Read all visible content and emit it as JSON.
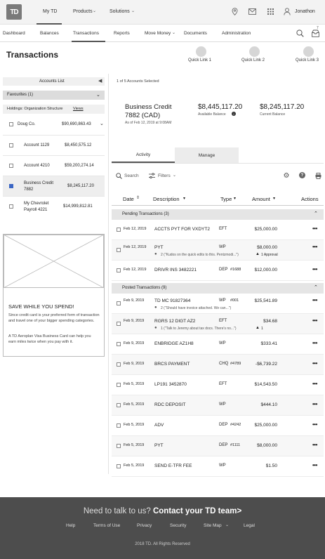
{
  "topbar": {
    "logo": "TD",
    "nav": [
      "My TD",
      "Products",
      "Solutions"
    ],
    "user": "Jonathon"
  },
  "subnav": {
    "items": [
      "Dashboard",
      "Balances",
      "Transactions",
      "Reports",
      "Move Money",
      "Documents",
      "Administration"
    ],
    "badge": "7"
  },
  "page": {
    "title": "Transactions",
    "quick_links": [
      "Quick Link 1",
      "Quick Link 2",
      "Quick Link 3"
    ]
  },
  "sidebar": {
    "accounts_list": "Accounts List",
    "favourites": "Favourites (1)",
    "holdings": "Holdings: Organization Structure",
    "views": "Views",
    "company": "Doug Co.",
    "company_total": "$90,690,863.43",
    "accounts": [
      {
        "name": "Account 1129",
        "amount": "$8,450,575.12",
        "checked": false
      },
      {
        "name": "Account 4210",
        "amount": "$59,200,274.14",
        "checked": false
      },
      {
        "name": "Business Credit 7882",
        "amount": "$8,245,117.20",
        "checked": true
      },
      {
        "name": "My Chevrolet Payroll 4221",
        "amount": "$14,999,812.81",
        "checked": false
      }
    ],
    "ad": {
      "title": "SAVE WHILE YOU SPEND!",
      "p1": "Since credit card is your preferred form of transaction and travel one of your bigger spending categories.",
      "p2": "A TD Aeroplan Visa Business Card can help you earn miles twice when you pay with it."
    }
  },
  "main": {
    "selected_count": "1 of 5 Accounts Selected",
    "account_name": "Business Credit 7882 (CAD)",
    "as_of": "As of Feb 12, 2019 at 9:08AM",
    "available_balance": "$8,445,117.20",
    "available_label": "Available Balance",
    "current_balance": "$8,245,117.20",
    "current_label": "Current Balance",
    "tabs": [
      "Activity",
      "Manage"
    ],
    "search": "Search",
    "filters": "Filters",
    "columns": [
      "Date",
      "Description",
      "Type",
      "Amount",
      "Actions"
    ],
    "pending_label": "Pending Transactions (3)",
    "posted_label": "Posted Transactions (9)",
    "pending": [
      {
        "date": "Feb 12, 2019",
        "desc": "ACCTS PYT FOR VXDYT2",
        "type": "EFT",
        "ref": "",
        "amount": "$25,000.00",
        "comment": "",
        "approval": ""
      },
      {
        "date": "Feb 12, 2019",
        "desc": "PYT",
        "type": "WP",
        "ref": "",
        "amount": "$8,000.00",
        "comment": "2 (\"Kudos on the quick edits to this. Pentzmodi...\")",
        "approval": "1 Approval"
      },
      {
        "date": "Feb 12, 2019",
        "desc": "DRIVR INS 3482221",
        "type": "DEP",
        "ref": "#1688",
        "amount": "$12,000.00",
        "comment": "",
        "approval": ""
      }
    ],
    "posted": [
      {
        "date": "Feb 9, 2019",
        "desc": "TD MC 91827364",
        "type": "WP",
        "ref": "#001",
        "amount": "$25,541.89",
        "comment": "2 (\"Should have invoice attached. We can...\")",
        "approval": ""
      },
      {
        "date": "Feb 9, 2019",
        "desc": "RGRS 12 DIGT AZ2",
        "type": "EFT",
        "ref": "",
        "amount": "$34.68",
        "comment": "1 (\"Talk to Jeremy about tax docs. There's no...\")",
        "approval": "1"
      },
      {
        "date": "Feb 9, 2019",
        "desc": "ENBRIDGE AZ1H8",
        "type": "WP",
        "ref": "",
        "amount": "$333.41",
        "comment": "",
        "approval": ""
      },
      {
        "date": "Feb 9, 2019",
        "desc": "BRCS PAYMENT",
        "type": "CHQ",
        "ref": "#4789",
        "amount": "-$6,739.22",
        "comment": "",
        "approval": ""
      },
      {
        "date": "Feb 5, 2019",
        "desc": "LP191 3452870",
        "type": "EFT",
        "ref": "",
        "amount": "$14,543.50",
        "comment": "",
        "approval": ""
      },
      {
        "date": "Feb 5, 2019",
        "desc": "RDC DEPOSIT",
        "type": "WP",
        "ref": "",
        "amount": "$444.10",
        "comment": "",
        "approval": ""
      },
      {
        "date": "Feb 5, 2019",
        "desc": "ADV",
        "type": "DEP",
        "ref": "#4242",
        "amount": "$25,000.00",
        "comment": "",
        "approval": ""
      },
      {
        "date": "Feb 5, 2019",
        "desc": "PYT",
        "type": "DEP",
        "ref": "#1111",
        "amount": "$8,000.00",
        "comment": "",
        "approval": ""
      },
      {
        "date": "Feb 5, 2019",
        "desc": "SEND E-TFR FEE",
        "type": "WP",
        "ref": "",
        "amount": "$1.50",
        "comment": "",
        "approval": ""
      }
    ]
  },
  "footer": {
    "cta_prefix": "Need to talk to us?",
    "cta_link": "Contact your TD team>",
    "links": [
      "Help",
      "Terms of Use",
      "Privacy",
      "Security",
      "Site Map",
      "Legal"
    ],
    "copyright": "2018 TD. All Rights Reserved"
  }
}
